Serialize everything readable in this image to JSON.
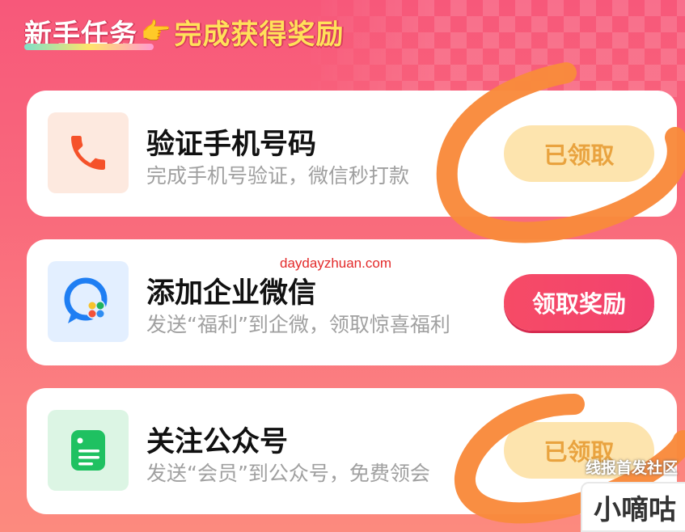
{
  "header": {
    "title_left": "新手任务",
    "title_right": "完成获得奖励",
    "hand_icon": "pointing-hand-icon"
  },
  "tasks": [
    {
      "title": "验证手机号码",
      "desc": "完成手机号验证，微信秒打款",
      "button": "已领取",
      "status": "claimed",
      "icon": "phone-icon"
    },
    {
      "title": "添加企业微信",
      "desc": "发送“福利”到企微，领取惊喜福利",
      "button": "领取奖励",
      "status": "available",
      "icon": "wecom-icon"
    },
    {
      "title": "关注公众号",
      "desc": "发送“会员”到公众号，免费领会",
      "button": "已领取",
      "status": "claimed",
      "icon": "document-icon"
    }
  ],
  "watermark": "daydayzhuan.com",
  "corner": {
    "line": "线报首发社区",
    "name": "小嘀咕"
  },
  "colors": {
    "background": "#f7587a",
    "claimed_bg": "#fde4ae",
    "claimed_text": "#e9a33f",
    "claim_btn": "#f64b66",
    "scribble": "#f98a3c"
  }
}
